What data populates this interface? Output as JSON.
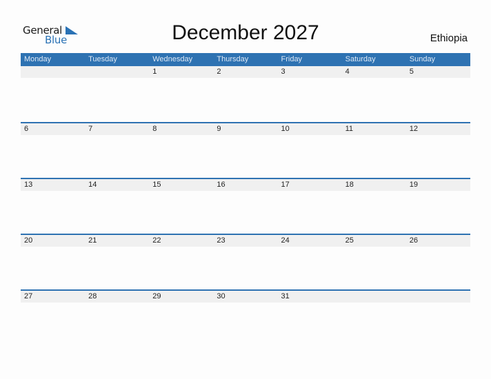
{
  "logo": {
    "line1": "General",
    "line2": "Blue",
    "brand_color": "#2a72b5"
  },
  "title": "December 2027",
  "country": "Ethiopia",
  "header_color": "#2e72b2",
  "weekdays": [
    "Monday",
    "Tuesday",
    "Wednesday",
    "Thursday",
    "Friday",
    "Saturday",
    "Sunday"
  ],
  "weeks": [
    [
      "",
      "",
      "1",
      "2",
      "3",
      "4",
      "5"
    ],
    [
      "6",
      "7",
      "8",
      "9",
      "10",
      "11",
      "12"
    ],
    [
      "13",
      "14",
      "15",
      "16",
      "17",
      "18",
      "19"
    ],
    [
      "20",
      "21",
      "22",
      "23",
      "24",
      "25",
      "26"
    ],
    [
      "27",
      "28",
      "29",
      "30",
      "31",
      "",
      ""
    ]
  ]
}
